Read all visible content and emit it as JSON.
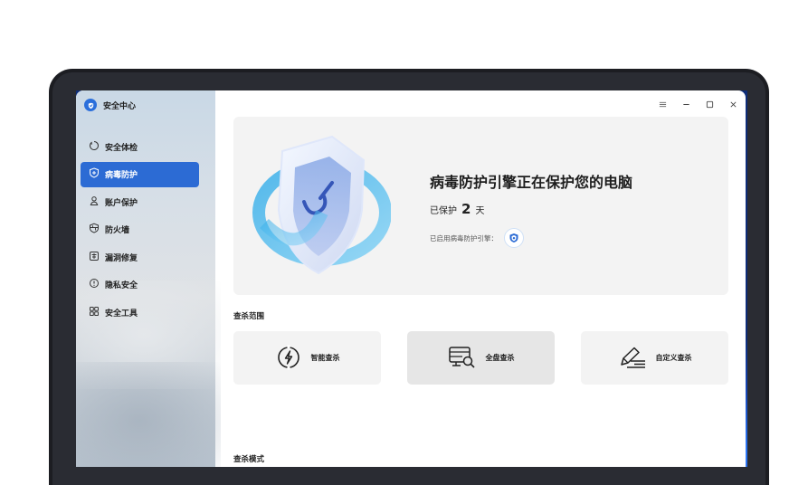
{
  "app": {
    "title": "安全中心"
  },
  "sidebar": {
    "items": [
      {
        "label": "安全体检",
        "icon": "clock-icon",
        "active": false
      },
      {
        "label": "病毒防护",
        "icon": "shield-icon",
        "active": true
      },
      {
        "label": "账户保护",
        "icon": "user-icon",
        "active": false
      },
      {
        "label": "防火墙",
        "icon": "firewall-icon",
        "active": false
      },
      {
        "label": "漏洞修复",
        "icon": "patch-icon",
        "active": false
      },
      {
        "label": "隐私安全",
        "icon": "privacy-icon",
        "active": false
      },
      {
        "label": "安全工具",
        "icon": "grid-icon",
        "active": false
      }
    ]
  },
  "window_controls": [
    "menu-icon",
    "minimize-icon",
    "maximize-icon",
    "close-icon"
  ],
  "hero": {
    "title": "病毒防护引擎正在保护您的电脑",
    "protected_prefix": "已保护",
    "protected_days": "2",
    "protected_suffix": "天",
    "engine_label": "已启用病毒防护引擎："
  },
  "scan_scope": {
    "title": "查杀范围",
    "options": [
      {
        "label": "智能查杀",
        "icon": "lightning-icon",
        "selected": false
      },
      {
        "label": "全盘查杀",
        "icon": "disk-scan-icon",
        "selected": true
      },
      {
        "label": "自定义查杀",
        "icon": "pen-icon",
        "selected": false
      }
    ]
  },
  "scan_mode": {
    "title": "查杀模式"
  },
  "colors": {
    "accent": "#2c6bd4",
    "screen": "#0e2d78",
    "card": "#f3f3f3"
  }
}
